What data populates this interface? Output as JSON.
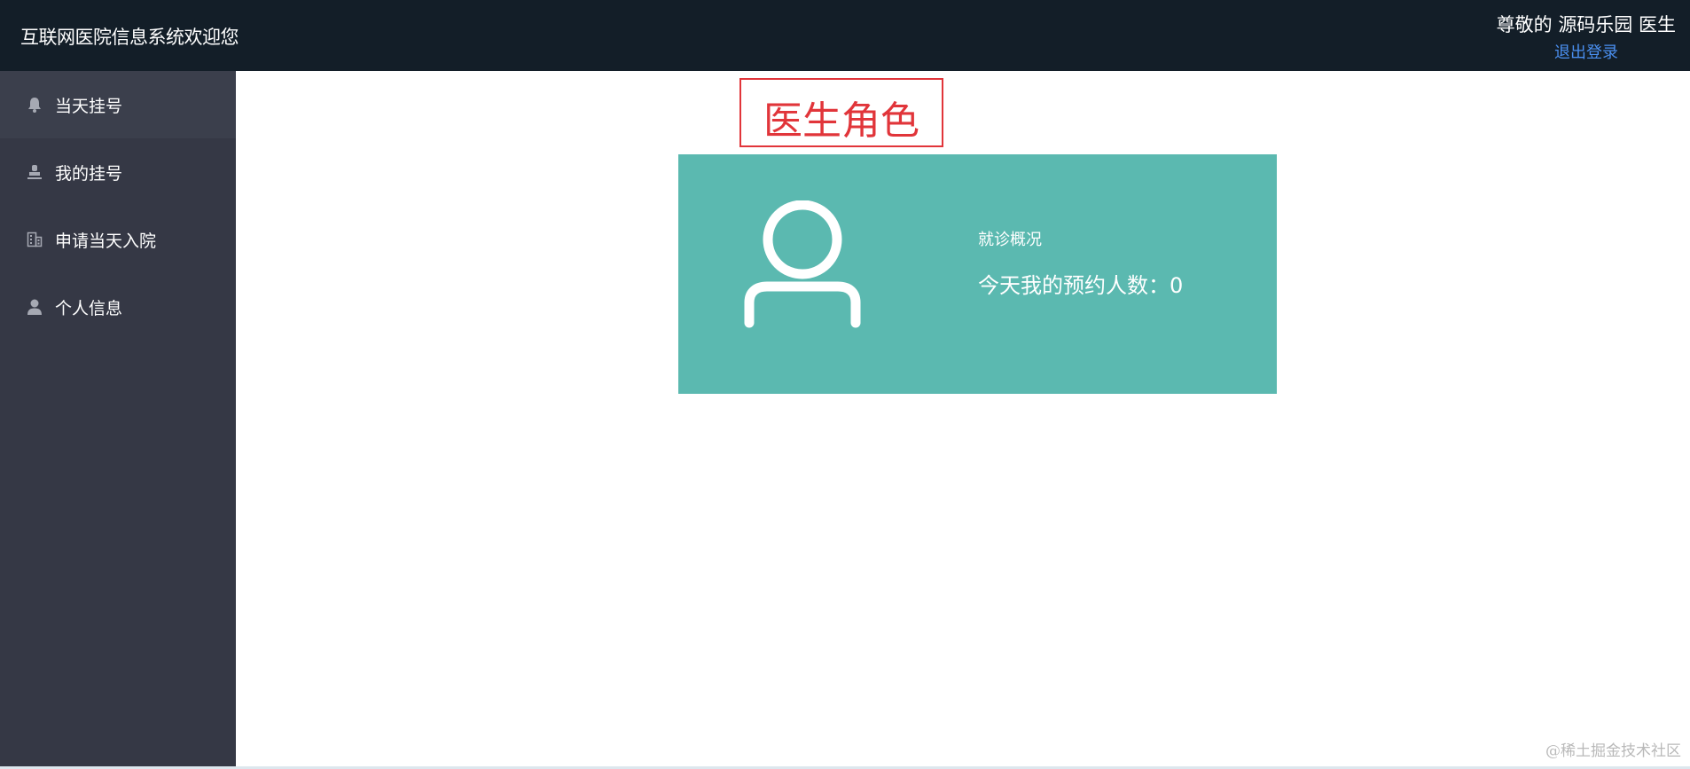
{
  "header": {
    "app_title": "互联网医院信息系统欢迎您",
    "greeting_prefix": "尊敬的",
    "user_name": "源码乐园",
    "user_role": "医生",
    "logout_label": "退出登录"
  },
  "sidebar": {
    "items": [
      {
        "label": "当天挂号",
        "icon": "bell-icon"
      },
      {
        "label": "我的挂号",
        "icon": "stamp-icon"
      },
      {
        "label": "申请当天入院",
        "icon": "building-icon"
      },
      {
        "label": "个人信息",
        "icon": "person-icon"
      }
    ]
  },
  "main": {
    "annotation": "医生角色",
    "card": {
      "subtitle": "就诊概况",
      "stat_label": "今天我的预约人数：",
      "stat_value": "0",
      "icon": "user-outline-icon"
    }
  },
  "watermark": "@稀土掘金技术社区",
  "colors": {
    "topbar": "#131e28",
    "sidebar": "#353845",
    "card": "#5bb9b0",
    "annotation": "#e1353a",
    "link": "#4a8ff0"
  }
}
